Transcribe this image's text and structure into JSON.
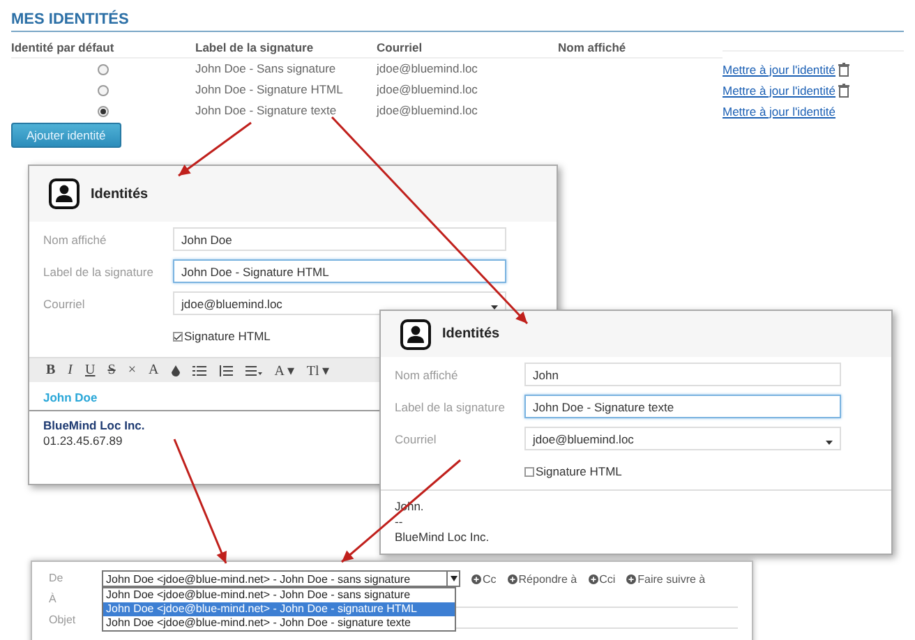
{
  "identities": {
    "title": "MES IDENTITÉS",
    "columns": [
      "Identité par défaut",
      "Label de la signature",
      "Courriel",
      "Nom affiché"
    ],
    "rows": [
      {
        "selected": false,
        "label": "John Doe - Sans signature",
        "email": "jdoe@bluemind.loc",
        "action": "Mettre à jour l'identité",
        "deletable": true
      },
      {
        "selected": false,
        "label": "John Doe - Signature HTML",
        "email": "jdoe@bluemind.loc",
        "action": "Mettre à jour l'identité",
        "deletable": true
      },
      {
        "selected": true,
        "label": "John Doe - Signature texte",
        "email": "jdoe@bluemind.loc",
        "action": "Mettre à jour l'identité",
        "deletable": false
      }
    ],
    "add_button": "Ajouter identité"
  },
  "dialogs": [
    {
      "title": "Identités",
      "kind": "html",
      "fields": [
        {
          "kind": "text",
          "label": "Nom affiché",
          "value": "John Doe",
          "focused": false
        },
        {
          "kind": "text",
          "label": "Label de la signature",
          "value": "John Doe - Signature HTML",
          "focused": true
        },
        {
          "kind": "select",
          "label": "Courriel",
          "value": "jdoe@bluemind.loc",
          "focused": false
        }
      ],
      "checkbox": {
        "label": "Signature HTML",
        "checked": true
      },
      "toolbar": [
        "B",
        "I",
        "U",
        "S",
        "×",
        "A",
        "A ▾",
        "Tl ▾"
      ],
      "signature": [
        {
          "kind": "name",
          "text": "John Doe"
        },
        {
          "kind": "company",
          "text": "BlueMind Loc Inc."
        },
        {
          "kind": "plain",
          "text": "01.23.45.67.89"
        }
      ]
    },
    {
      "title": "Identités",
      "kind": "text",
      "fields": [
        {
          "kind": "text",
          "label": "Nom affiché",
          "value": "John",
          "focused": false
        },
        {
          "kind": "text",
          "label": "Label de la signature",
          "value": "John Doe - Signature texte",
          "focused": true
        },
        {
          "kind": "select",
          "label": "Courriel",
          "value": "jdoe@bluemind.loc",
          "focused": false
        }
      ],
      "checkbox": {
        "label": "Signature HTML",
        "checked": false
      },
      "signature": [
        {
          "kind": "plain",
          "text": "John."
        },
        {
          "kind": "plain",
          "text": "--"
        },
        {
          "kind": "plain",
          "text": "BlueMind Loc Inc."
        }
      ]
    }
  ],
  "compose": {
    "labels": [
      "De",
      "À",
      "Objet"
    ],
    "from_value": "John Doe <jdoe@blue-mind.net> - John Doe - sans signature",
    "options": [
      {
        "text": "John Doe <jdoe@blue-mind.net> - John Doe - sans signature",
        "selected": false
      },
      {
        "text": "John Doe <jdoe@blue-mind.net> - John Doe - signature HTML",
        "selected": true
      },
      {
        "text": "John Doe <jdoe@blue-mind.net> - John Doe - signature texte",
        "selected": false
      }
    ],
    "buttons": [
      "Cc",
      "Répondre à",
      "Cci",
      "Faire suivre à"
    ]
  }
}
